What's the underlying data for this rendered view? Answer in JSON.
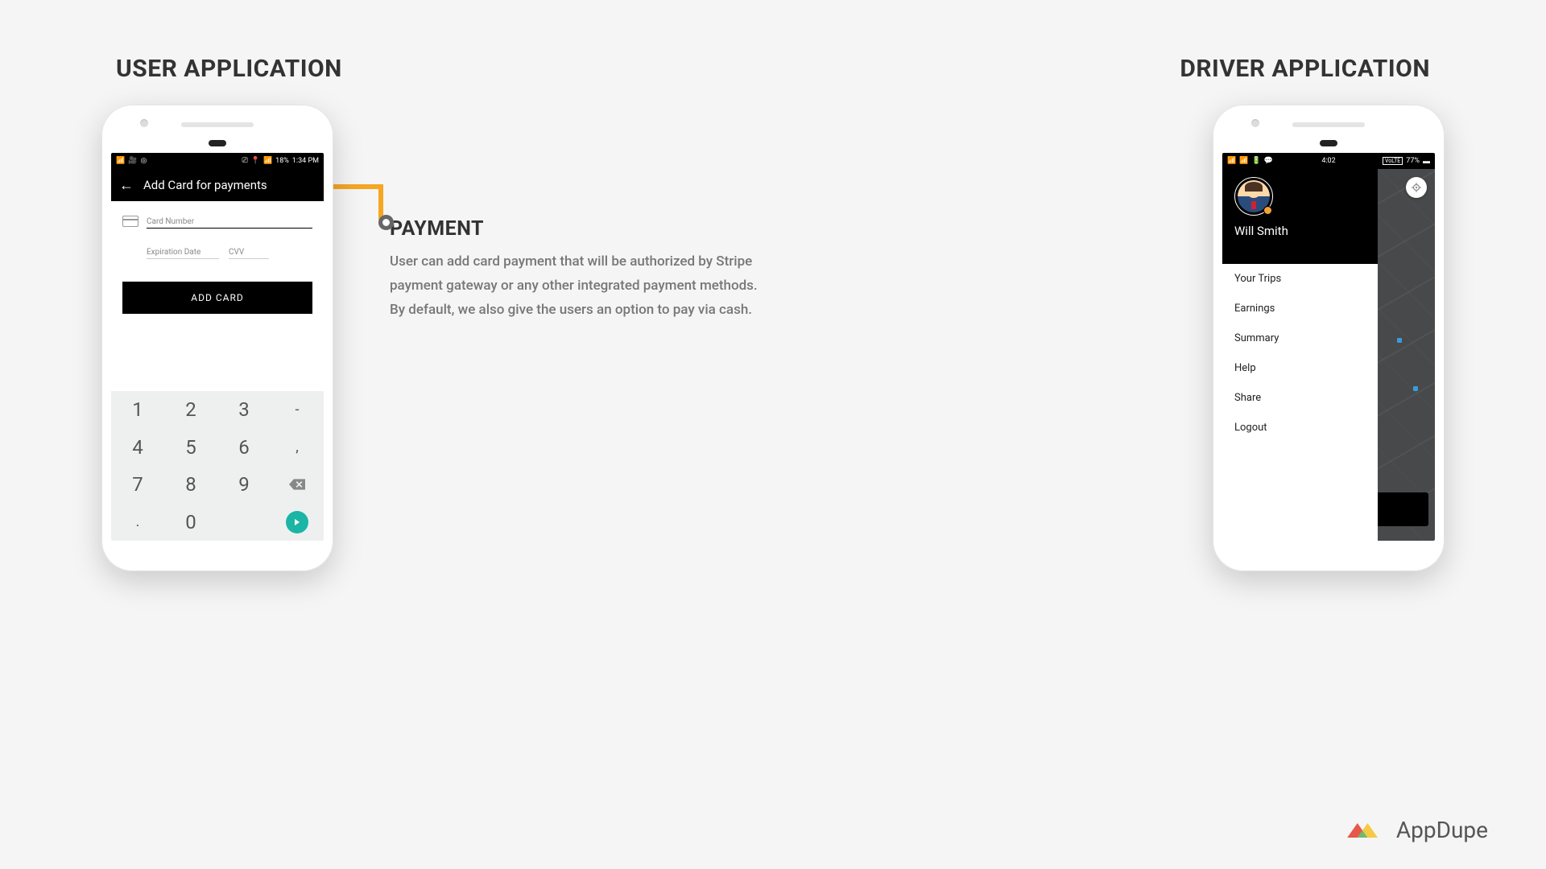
{
  "titles": {
    "user_app": "USER APPLICATION",
    "driver_app": "DRIVER APPLICATION"
  },
  "user_phone": {
    "status_time": "1:34 PM",
    "status_battery": "18%",
    "appbar_title": "Add Card for payments",
    "card_number_label": "Card Number",
    "expiration_label": "Expiration Date",
    "cvv_label": "CVV",
    "add_card_button": "ADD CARD",
    "keypad": {
      "r1": [
        "1",
        "2",
        "3",
        "-"
      ],
      "r2": [
        "4",
        "5",
        "6",
        ","
      ],
      "r3": [
        "7",
        "8",
        "9"
      ],
      "r4": [
        ".",
        "0"
      ]
    }
  },
  "driver_phone": {
    "status_time": "4:02",
    "status_battery": "77%",
    "driver_name": "Will Smith",
    "menu": {
      "trips": "Your Trips",
      "earnings": "Earnings",
      "summary": "Summary",
      "help": "Help",
      "share": "Share",
      "logout": "Logout"
    }
  },
  "description": {
    "title": "PAYMENT",
    "body": "User can add card payment that will be authorized by Stripe payment gateway or any other integrated payment methods. By default, we also give the users an option to pay via cash."
  },
  "brand": {
    "name": "AppDupe"
  },
  "colors": {
    "accent": "#f5a623",
    "teal": "#1bb5a5"
  }
}
